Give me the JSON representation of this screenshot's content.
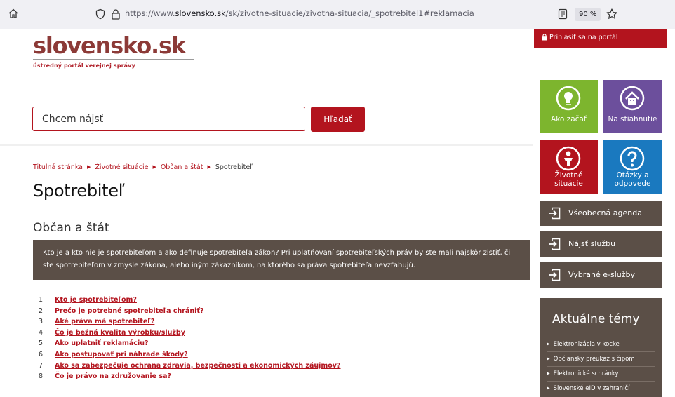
{
  "browser": {
    "url_prefix": "https://www.",
    "url_domain": "slovensko.sk",
    "url_path": "/sk/zivotne-situacie/zivotna-situacia/_spotrebitel1#reklamacia",
    "zoom": "90 %"
  },
  "logo": {
    "name": "slovensko.sk",
    "subtitle": "ústredný portál verejnej správy"
  },
  "search": {
    "placeholder": "Chcem nájsť",
    "button_label": "Hľadať"
  },
  "breadcrumb": {
    "items": [
      "Titulná stránka",
      "Životné situácie",
      "Občan a štát"
    ],
    "current": "Spotrebiteľ"
  },
  "page": {
    "title": "Spotrebiteľ",
    "section": "Občan a štát",
    "intro": "Kto je a kto nie je spotrebiteľom a ako definuje spotrebiteľa zákon? Pri uplatňovaní spotrebiteľských práv by ste mali najskôr zistiť, či ste spotrebiteľom v zmysle zákona, alebo iným zákazníkom, na ktorého sa práva spotrebiteľa nevzťahujú."
  },
  "toc": [
    {
      "num": "1.",
      "label": "Kto je spotrebiteľom?"
    },
    {
      "num": "2.",
      "label": "Prečo je potrebné spotrebiteľa chrániť?"
    },
    {
      "num": "3.",
      "label": "Aké práva má spotrebiteľ?"
    },
    {
      "num": "4.",
      "label": "Čo je bežná kvalita výrobku/služby"
    },
    {
      "num": "5.",
      "label": "Ako uplatniť reklamáciu?"
    },
    {
      "num": "6.",
      "label": "Ako postupovať pri náhrade škody?"
    },
    {
      "num": "7.",
      "label": "Ako sa zabezpečuje ochrana zdravia, bezpečnosti a ekonomických záujmov?"
    },
    {
      "num": "8.",
      "label": "Čo je právo na združovanie sa?"
    }
  ],
  "sidebar": {
    "login_label": "Prihlásiť sa na portál",
    "tiles": {
      "start": "Ako začať",
      "download": "Na stiahnutie",
      "life_line1": "Životné",
      "life_line2": "situácie",
      "faq_line1": "Otázky a",
      "faq_line2": "odpovede"
    },
    "buttons": {
      "agenda": "Všeobecná agenda",
      "find_service": "Nájsť službu",
      "eservices": "Vybrané e-služby"
    },
    "topics": {
      "title": "Aktuálne témy",
      "items": [
        "Elektronizácia v kocke",
        "Občiansky preukaz s čipom",
        "Elektronické schránky",
        "Slovenské eID v zahraničí"
      ]
    }
  },
  "colors": {
    "brand_red": "#b3141e",
    "brown": "#5b4f47",
    "green": "#7db52e",
    "purple": "#6c4f9c",
    "blue": "#1a79bf"
  }
}
